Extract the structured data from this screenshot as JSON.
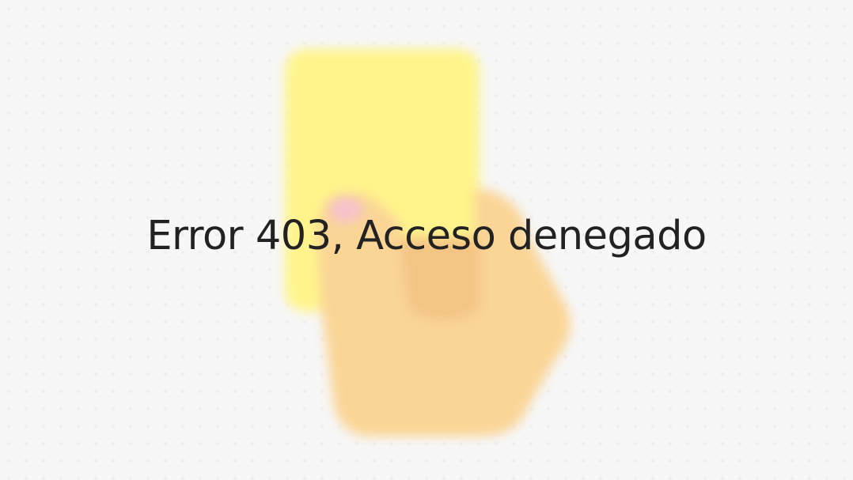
{
  "error_page": {
    "message": "Error 403, Acceso denegado",
    "illustration_icon": "hand-holding-yellow-card-icon",
    "colors": {
      "background": "#f7f7f7",
      "card": "#fff48c",
      "hand": "#fad596",
      "hand_shadow": "#f3c585",
      "fingernail": "#f7c2cc",
      "text": "#222222"
    }
  }
}
